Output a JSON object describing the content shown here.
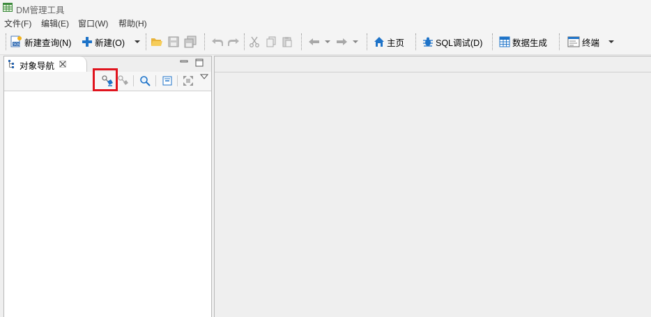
{
  "window": {
    "title": "DM管理工具"
  },
  "menu": [
    "文件(F)",
    "编辑(E)",
    "窗口(W)",
    "帮助(H)"
  ],
  "toolbar": {
    "new_query": "新建查询(N)",
    "new": "新建(O)",
    "home": "主页",
    "sql_debug": "SQL调试(D)",
    "data_gen": "数据生成",
    "terminal": "终端"
  },
  "navigator": {
    "tab_label": "对象导航"
  },
  "colors": {
    "highlight": "#e0141e",
    "accent_blue": "#1e73c8"
  },
  "icons": [
    "database-grid-icon",
    "new-query-icon",
    "plus-icon",
    "folder-open-icon",
    "save-icon",
    "save-all-icon",
    "undo-icon",
    "redo-icon",
    "cut-icon",
    "copy-icon",
    "paste-icon",
    "back-arrow-icon",
    "forward-arrow-icon",
    "home-icon",
    "bug-icon",
    "data-generate-icon",
    "terminal-icon",
    "new-connection-icon",
    "disconnect-icon",
    "search-icon",
    "collapse-icon",
    "maximize-icon",
    "view-menu-icon"
  ]
}
